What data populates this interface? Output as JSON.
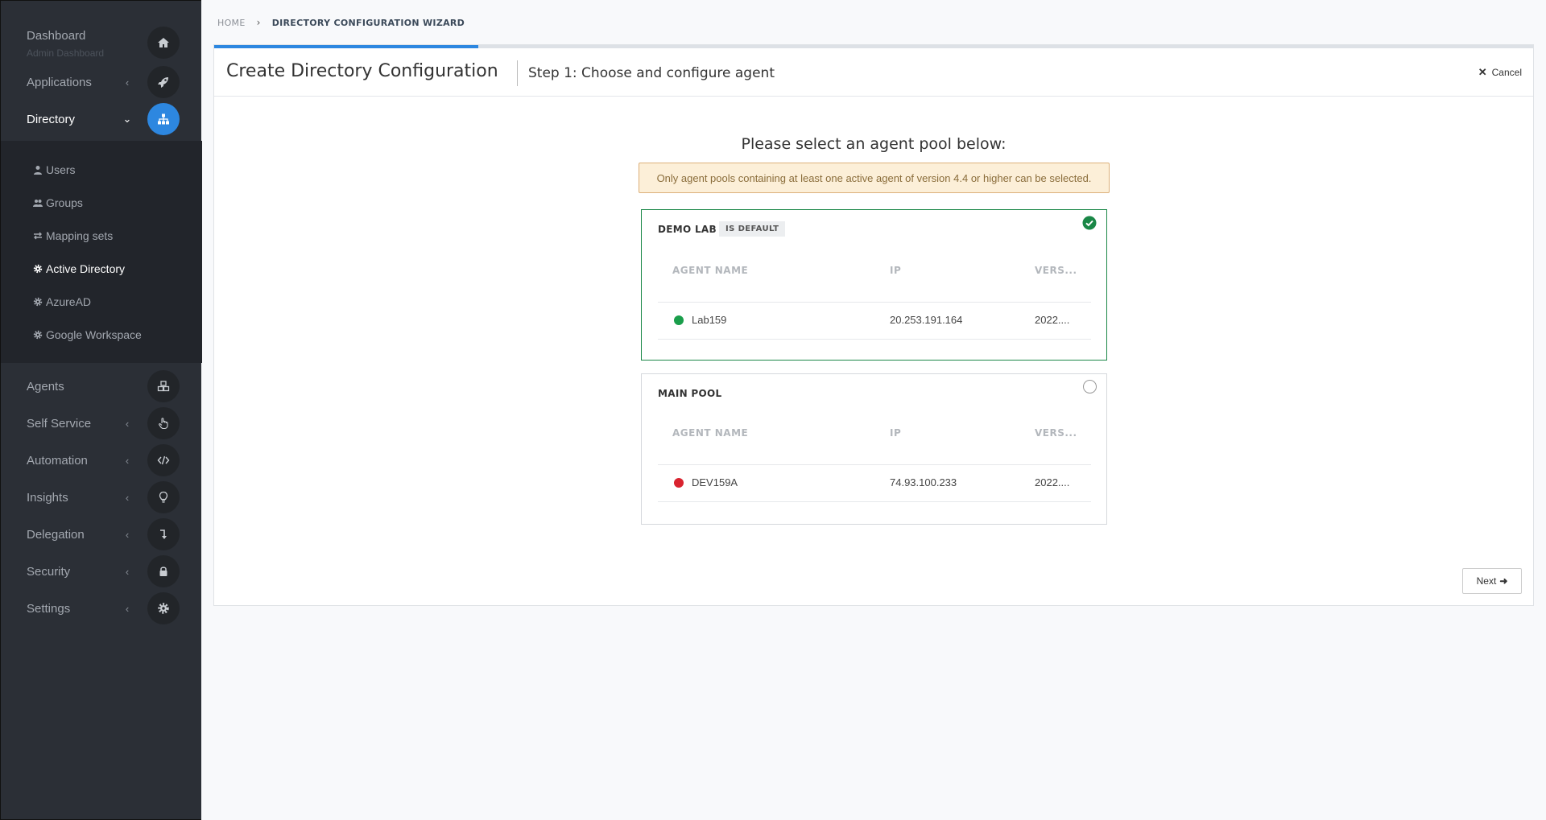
{
  "sidebar": {
    "dashboard": {
      "label": "Dashboard",
      "sublabel": "Admin Dashboard",
      "icon": "home-icon"
    },
    "applications": {
      "label": "Applications",
      "icon": "rocket-icon"
    },
    "directory": {
      "label": "Directory",
      "icon": "sitemap-icon"
    },
    "directory_items": [
      {
        "label": "Users",
        "icon": "user-icon"
      },
      {
        "label": "Groups",
        "icon": "users-icon"
      },
      {
        "label": "Mapping sets",
        "icon": "exchange-icon"
      },
      {
        "label": "Active Directory",
        "icon": "cog-icon"
      },
      {
        "label": "AzureAD",
        "icon": "cog-icon"
      },
      {
        "label": "Google Workspace",
        "icon": "cog-icon"
      }
    ],
    "agents": {
      "label": "Agents",
      "icon": "cubes-icon"
    },
    "self_service": {
      "label": "Self Service",
      "icon": "hand-pointer-icon"
    },
    "automation": {
      "label": "Automation",
      "icon": "code-icon"
    },
    "insights": {
      "label": "Insights",
      "icon": "lightbulb-icon"
    },
    "delegation": {
      "label": "Delegation",
      "icon": "level-down-icon"
    },
    "security": {
      "label": "Security",
      "icon": "lock-icon"
    },
    "settings": {
      "label": "Settings",
      "icon": "gear-icon"
    }
  },
  "breadcrumb": {
    "home": "HOME",
    "current": "DIRECTORY CONFIGURATION WIZARD"
  },
  "wizard": {
    "title": "Create Directory Configuration",
    "step": "Step 1: Choose and configure agent",
    "cancel": "Cancel",
    "progress": 0.2,
    "prompt": "Please select an agent pool below:",
    "warning": "Only agent pools containing at least one active agent of version 4.4 or higher can be selected.",
    "columns": {
      "name": "AGENT NAME",
      "ip": "IP",
      "version": "VERS..."
    },
    "pools": [
      {
        "name": "DEMO LAB",
        "badge": "IS DEFAULT",
        "selected": true,
        "agent": {
          "name": "Lab159",
          "ip": "20.253.191.164",
          "version": "2022....",
          "status_color": "#1a9e4b"
        }
      },
      {
        "name": "MAIN POOL",
        "badge": "",
        "selected": false,
        "agent": {
          "name": "DEV159A",
          "ip": "74.93.100.233",
          "version": "2022....",
          "status_color": "#d9232f"
        }
      }
    ],
    "next": "Next"
  },
  "colors": {
    "accent": "#2d87e0",
    "selected_border": "#1a8747",
    "sidebar_bg": "#2b2f36"
  }
}
